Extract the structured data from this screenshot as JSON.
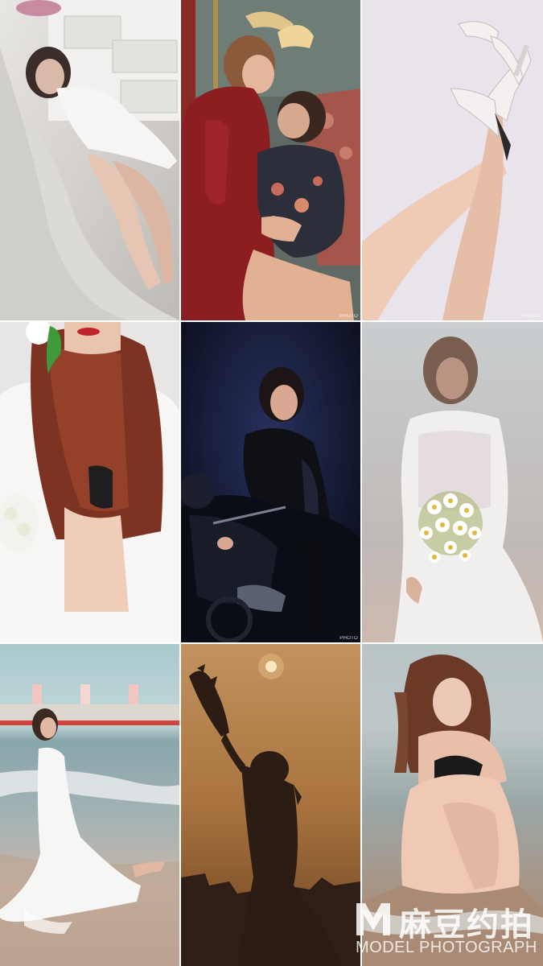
{
  "photos": [
    {
      "id": 1,
      "subject": "woman in white lace dress on tulle bed",
      "watermark": ""
    },
    {
      "id": 2,
      "subject": "two women in qipao dresses embracing",
      "watermark": "PHOTO"
    },
    {
      "id": 3,
      "subject": "legs with white high heels",
      "watermark": "PHOTO"
    },
    {
      "id": 4,
      "subject": "woman with long red hair and green flower",
      "watermark": ""
    },
    {
      "id": 5,
      "subject": "woman in leather on motorcycle at night",
      "watermark": "PHOTO"
    },
    {
      "id": 6,
      "subject": "bride holding daisy bouquet",
      "watermark": ""
    },
    {
      "id": 7,
      "subject": "woman in white dress on beach",
      "watermark": ""
    },
    {
      "id": 8,
      "subject": "silhouette holding flowers at sunset",
      "watermark": ""
    },
    {
      "id": 9,
      "subject": "woman sitting by the sea",
      "watermark": ""
    }
  ],
  "watermark": {
    "chinese": "麻豆约拍",
    "english": "MODEL PHOTOGRAPH"
  }
}
